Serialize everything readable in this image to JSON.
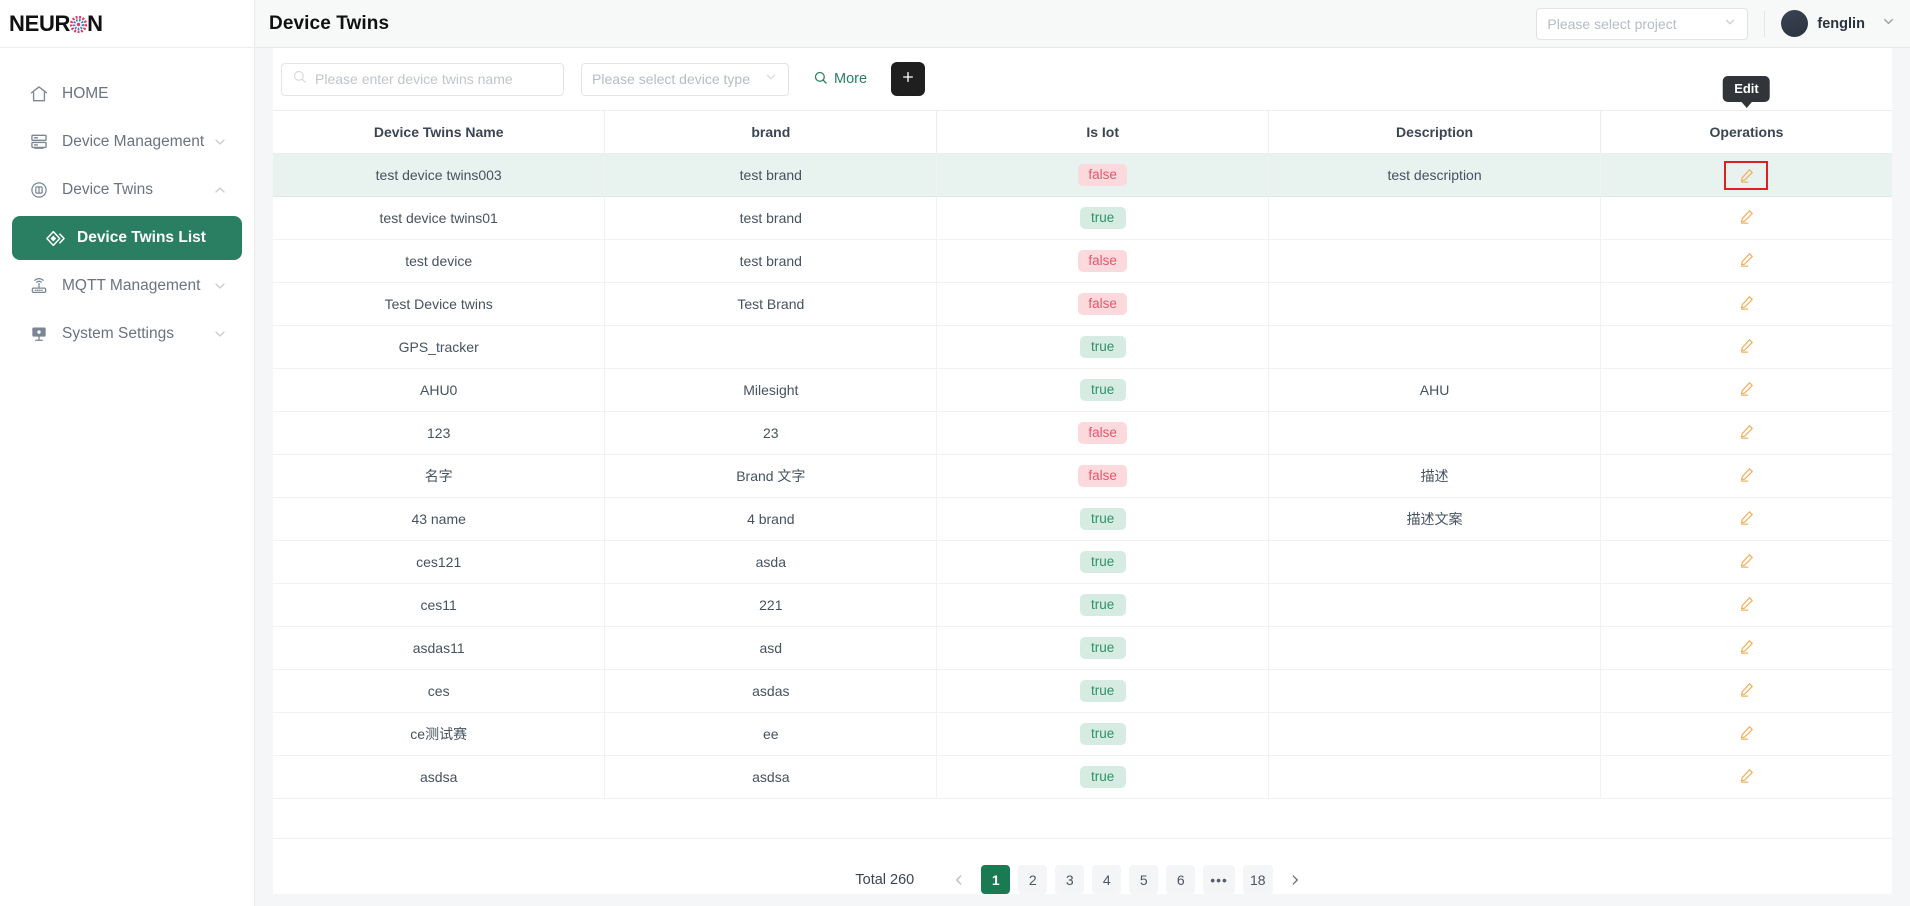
{
  "brand": {
    "name_a": "NEUR",
    "name_b": "N",
    "logo_icon": "neuron-circle-logo"
  },
  "sidebar": {
    "items": [
      {
        "label": "HOME",
        "icon": "home-icon",
        "expandable": false,
        "active": false
      },
      {
        "label": "Device Management",
        "icon": "server-rack-icon",
        "expandable": true,
        "active": false
      },
      {
        "label": "Device Twins",
        "icon": "device-twins-icon",
        "expandable": true,
        "expanded": true,
        "active": false
      },
      {
        "label": "Device Twins List",
        "icon": "layers-diamond-icon",
        "expandable": false,
        "active": true,
        "sub": true
      },
      {
        "label": "MQTT Management",
        "icon": "router-icon",
        "expandable": true,
        "active": false
      },
      {
        "label": "System Settings",
        "icon": "monitor-settings-icon",
        "expandable": true,
        "active": false
      }
    ]
  },
  "topbar": {
    "title": "Device Twins",
    "project_select_placeholder": "Please select project",
    "user_name": "fenglin",
    "avatar_icon": "user-avatar",
    "chevron_icon": "chevron-down-icon"
  },
  "toolbar": {
    "search_placeholder": "Please enter device twins name",
    "search_icon": "search-icon",
    "device_type_placeholder": "Please select device type",
    "more_label": "More",
    "more_icon": "search-icon",
    "add_icon": "plus-icon"
  },
  "table": {
    "columns": [
      "Device Twins Name",
      "brand",
      "Is Iot",
      "Description",
      "Operations"
    ],
    "edit_icon": "pencil-edit-icon",
    "tooltip": "Edit",
    "rows": [
      {
        "name": "test device twins003",
        "brand": "test brand",
        "is_iot": "false",
        "description": "test description",
        "highlighted": true,
        "tooltip": true
      },
      {
        "name": "test device twins01",
        "brand": "test brand",
        "is_iot": "true",
        "description": ""
      },
      {
        "name": "test device",
        "brand": "test brand",
        "is_iot": "false",
        "description": ""
      },
      {
        "name": "Test Device twins",
        "brand": "Test Brand",
        "is_iot": "false",
        "description": ""
      },
      {
        "name": "GPS_tracker",
        "brand": "",
        "is_iot": "true",
        "description": ""
      },
      {
        "name": "AHU0",
        "brand": "Milesight",
        "is_iot": "true",
        "description": "AHU"
      },
      {
        "name": "123",
        "brand": "23",
        "is_iot": "false",
        "description": ""
      },
      {
        "name": "名字",
        "brand": "Brand 文字",
        "is_iot": "false",
        "description": "描述"
      },
      {
        "name": "43 name",
        "brand": "4 brand",
        "is_iot": "true",
        "description": "描述文案"
      },
      {
        "name": "ces121",
        "brand": "asda",
        "is_iot": "true",
        "description": ""
      },
      {
        "name": "ces11",
        "brand": "221",
        "is_iot": "true",
        "description": ""
      },
      {
        "name": "asdas11",
        "brand": "asd",
        "is_iot": "true",
        "description": ""
      },
      {
        "name": "ces",
        "brand": "asdas",
        "is_iot": "true",
        "description": ""
      },
      {
        "name": "ce测试赛",
        "brand": "ee",
        "is_iot": "true",
        "description": ""
      },
      {
        "name": "asdsa",
        "brand": "asdsa",
        "is_iot": "true",
        "description": ""
      }
    ]
  },
  "pagination": {
    "total_label": "Total 260",
    "prev_icon": "chevron-left-icon",
    "next_icon": "chevron-right-icon",
    "pages": [
      "1",
      "2",
      "3",
      "4",
      "5",
      "6",
      "•••",
      "18"
    ],
    "active_page": "1"
  },
  "colors": {
    "accent_green": "#2a7f62",
    "pager_active": "#1a7a52",
    "badge_true_bg": "#d6ece2",
    "badge_true_fg": "#2f9268",
    "badge_false_bg": "#fbd9dd",
    "badge_false_fg": "#e8556d",
    "row_highlight": "#e8f2ee",
    "edit_icon": "#f2b261",
    "highlight_box": "#e02020",
    "add_button": "#1f1f1f"
  }
}
